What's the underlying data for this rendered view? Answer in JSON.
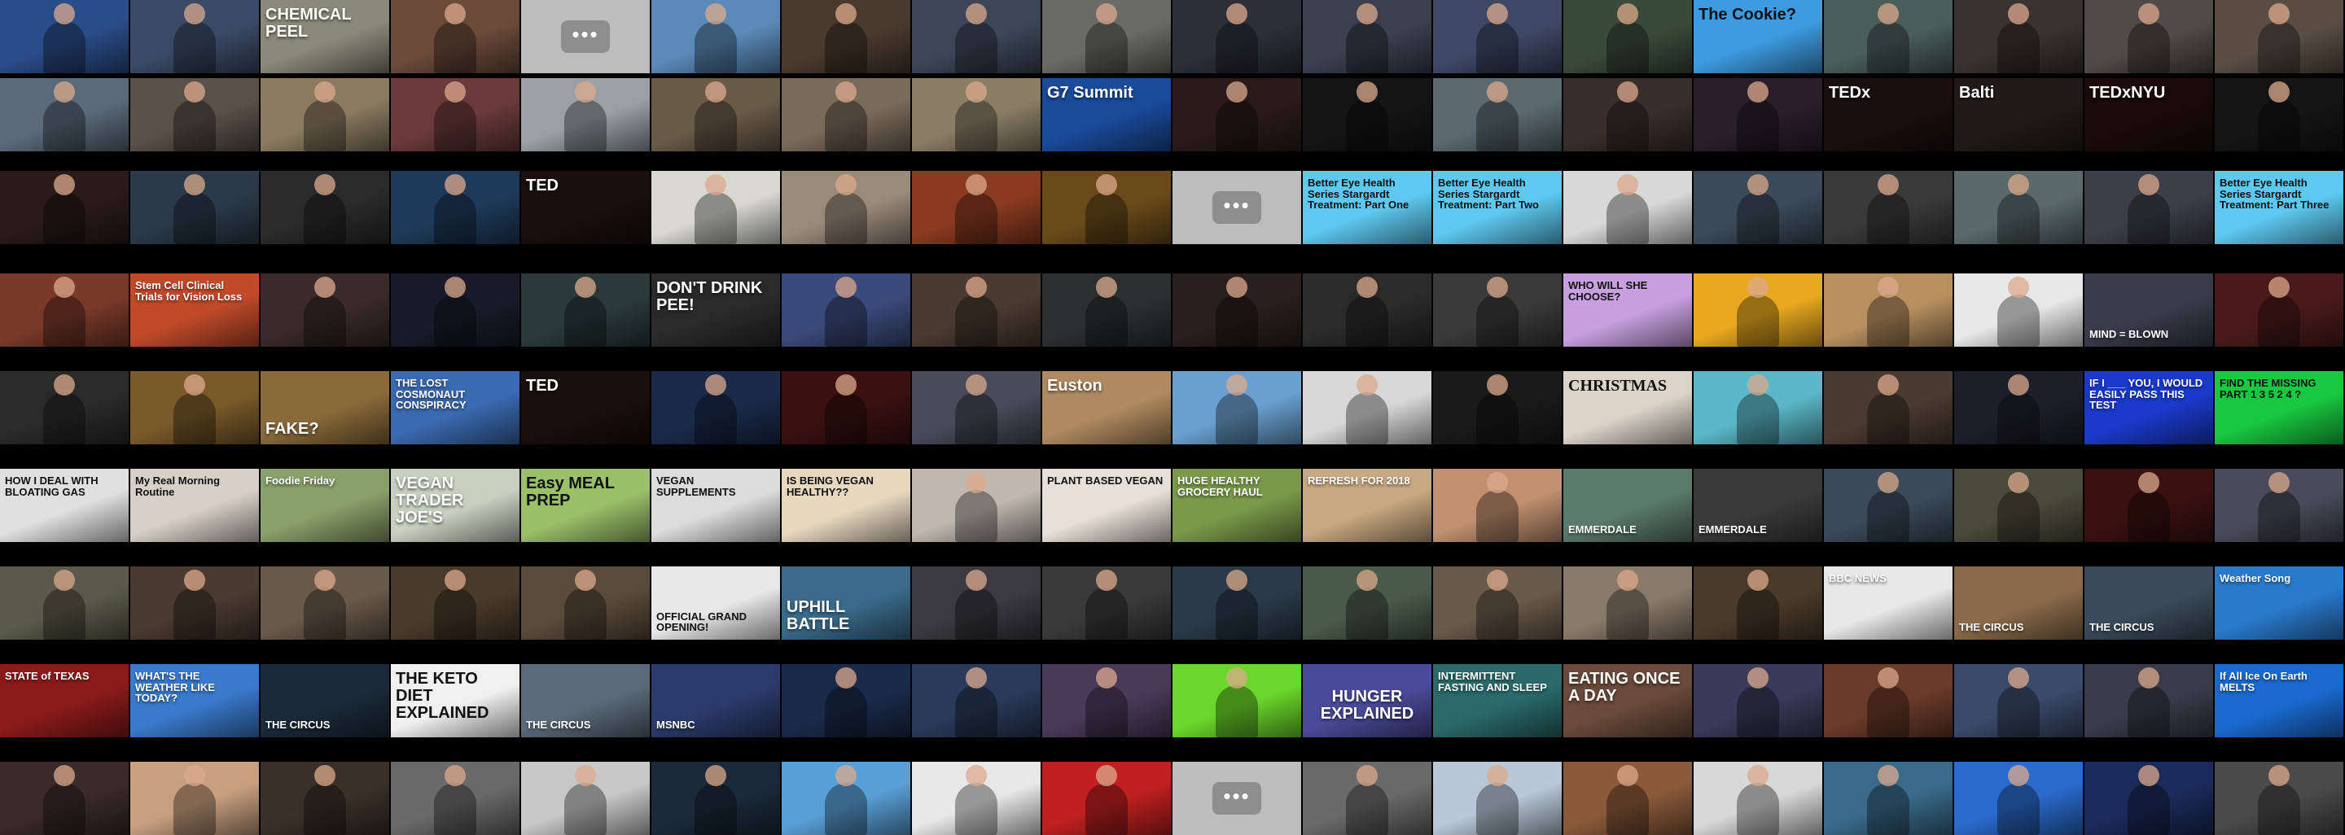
{
  "placeholder_glyph": "•••",
  "rows": [
    {
      "tiles": [
        {
          "bg": "#2a4c88"
        },
        {
          "bg": "#3a4a66"
        },
        {
          "bg": "#8a8a7a",
          "caption": "CHEMICAL PEEL"
        },
        {
          "bg": "#6b4a3a"
        },
        {
          "placeholder": true
        },
        {
          "bg": "#5a8ab8"
        },
        {
          "bg": "#4a3a2e"
        },
        {
          "bg": "#3c4658"
        },
        {
          "bg": "#6a6a66"
        },
        {
          "bg": "#2e2e3a"
        },
        {
          "bg": "#3a4050"
        },
        {
          "bg": "#3e4866"
        },
        {
          "bg": "#3a4a3a"
        },
        {
          "bg": "#3d9be0",
          "caption": "The Cookie?",
          "captionStyle": "dark"
        },
        {
          "bg": "#4a5e5a"
        },
        {
          "bg": "#3a3230"
        },
        {
          "bg": "#504a48"
        },
        {
          "bg": "#5a4e44"
        }
      ]
    },
    {
      "tiles": [
        {
          "bg": "#5a6a7a"
        },
        {
          "bg": "#5a5048"
        },
        {
          "bg": "#8a7a60"
        },
        {
          "bg": "#6a3a3a"
        },
        {
          "bg": "#9aa0a4"
        },
        {
          "bg": "#6a5a48"
        },
        {
          "bg": "#7a6a5a"
        },
        {
          "bg": "#8a7e66"
        },
        {
          "bg": "#1a4a9a",
          "caption": "G7 Summit"
        },
        {
          "bg": "#2a1a1a"
        },
        {
          "bg": "#141414"
        },
        {
          "bg": "#5a6a70"
        },
        {
          "bg": "#3a2e2a"
        },
        {
          "bg": "#2a1e2a"
        },
        {
          "bg": "#1a0e10",
          "caption": "TEDx"
        },
        {
          "bg": "#201a1a",
          "caption": "Balti"
        },
        {
          "bg": "#1a0a0a",
          "caption": "TEDxNYU"
        },
        {
          "bg": "#141414"
        }
      ]
    },
    {
      "tiles": [
        {
          "bg": "#2a1a1a"
        },
        {
          "bg": "#2a3a4a"
        },
        {
          "bg": "#2a2a2a"
        },
        {
          "bg": "#1e3a5a"
        },
        {
          "bg": "#1a0e0e",
          "caption": "TED"
        },
        {
          "bg": "#d8d8d0"
        },
        {
          "bg": "#9a8a7a"
        },
        {
          "bg": "#8a3a20"
        },
        {
          "bg": "#6a4a1a"
        },
        {
          "placeholder": true
        },
        {
          "bg": "#5ec8f0",
          "caption": "Better Eye Health Series Stargardt Treatment: Part One",
          "captionStyle": "small dark"
        },
        {
          "bg": "#5ec8f0",
          "caption": "Better Eye Health Series Stargardt Treatment: Part Two",
          "captionStyle": "small dark"
        },
        {
          "bg": "#d8d8d8"
        },
        {
          "bg": "#3a4a5a"
        },
        {
          "bg": "#3a3a3a"
        },
        {
          "bg": "#5a6a6a"
        },
        {
          "bg": "#3e3e4a"
        },
        {
          "bg": "#5ec8f0",
          "caption": "Better Eye Health Series Stargardt Treatment: Part Three",
          "captionStyle": "small dark"
        }
      ]
    },
    {
      "tiles": [
        {
          "bg": "#7a3a2a"
        },
        {
          "bg": "#c04a2a",
          "caption": "Stem Cell Clinical Trials for Vision Loss",
          "captionStyle": "small"
        },
        {
          "bg": "#3a2a2a"
        },
        {
          "bg": "#1a1a2a"
        },
        {
          "bg": "#2a3a3a"
        },
        {
          "bg": "#2a2a2a",
          "caption": "DON'T DRINK PEE!"
        },
        {
          "bg": "#3a4a7a"
        },
        {
          "bg": "#4a3a30"
        },
        {
          "bg": "#2a3030"
        },
        {
          "bg": "#2a1e1e"
        },
        {
          "bg": "#2a2a2a"
        },
        {
          "bg": "#3a3a3a"
        },
        {
          "bg": "#c8a0e0",
          "caption": "WHO WILL SHE CHOOSE?",
          "captionStyle": "small dark"
        },
        {
          "bg": "#e8a820"
        },
        {
          "bg": "#b89060"
        },
        {
          "bg": "#e8e8e8"
        },
        {
          "bg": "#3a3a4a",
          "caption": "MIND = BLOWN",
          "captionStyle": "small bottom"
        },
        {
          "bg": "#4a1a1a"
        }
      ]
    },
    {
      "tiles": [
        {
          "bg": "#2a2a2a"
        },
        {
          "bg": "#7a5a2a"
        },
        {
          "bg": "#8a6a3a",
          "caption": "FAKE?",
          "captionStyle": "bottom"
        },
        {
          "bg": "#3a6ab0",
          "caption": "THE LOST COSMONAUT CONSPIRACY",
          "captionStyle": "small"
        },
        {
          "bg": "#1a0e0e",
          "caption": "TED"
        },
        {
          "bg": "#1a2a4a"
        },
        {
          "bg": "#3a1010"
        },
        {
          "bg": "#4a4a5a"
        },
        {
          "bg": "#b08a60",
          "caption": "Euston"
        },
        {
          "bg": "#6aa0d0"
        },
        {
          "bg": "#d8d8d8"
        },
        {
          "bg": "#1a1a1a"
        },
        {
          "bg": "#dcd4c8",
          "caption": "CHRISTMAS",
          "captionStyle": "serif dark"
        },
        {
          "bg": "#5ab8c8"
        },
        {
          "bg": "#4a3a30"
        },
        {
          "bg": "#1e1e2a"
        },
        {
          "bg": "#1a3acc",
          "caption": "IF I ___ YOU, I WOULD EASILY PASS THIS TEST",
          "captionStyle": "small"
        },
        {
          "bg": "#18c840",
          "caption": "FIND THE MISSING PART 1 3 5 2 4 ?",
          "captionStyle": "small dark"
        }
      ]
    },
    {
      "tiles": [
        {
          "bg": "#e0e0e0",
          "caption": "HOW I DEAL WITH BLOATING GAS",
          "captionStyle": "small dark"
        },
        {
          "bg": "#d8d0c8",
          "caption": "My Real Morning Routine",
          "captionStyle": "small dark"
        },
        {
          "bg": "#8aa06a",
          "caption": "Foodie Friday",
          "captionStyle": "small"
        },
        {
          "bg": "#c8d0c0",
          "caption": "VEGAN TRADER JOE'S"
        },
        {
          "bg": "#9ac06a",
          "caption": "Easy MEAL PREP",
          "captionStyle": "dark"
        },
        {
          "bg": "#dcdcdc",
          "caption": "VEGAN SUPPLEMENTS",
          "captionStyle": "small dark"
        },
        {
          "bg": "#e8d8c0",
          "caption": "IS BEING VEGAN HEALTHY??",
          "captionStyle": "small dark"
        },
        {
          "bg": "#c0b8b0"
        },
        {
          "bg": "#e8e0d8",
          "caption": "PLANT BASED VEGAN",
          "captionStyle": "small dark"
        },
        {
          "bg": "#7a9a4a",
          "caption": "HUGE HEALTHY GROCERY HAUL",
          "captionStyle": "small"
        },
        {
          "bg": "#c8a880",
          "caption": "REFRESH FOR 2018",
          "captionStyle": "small"
        },
        {
          "bg": "#c09070"
        },
        {
          "bg": "#5a7a6a",
          "caption": "EMMERDALE",
          "captionStyle": "small bottom"
        },
        {
          "bg": "#3a3a3a",
          "caption": "EMMERDALE",
          "captionStyle": "small bottom"
        },
        {
          "bg": "#3a4a5a"
        },
        {
          "bg": "#4a4a3a"
        },
        {
          "bg": "#3a1010"
        },
        {
          "bg": "#4a4a5a"
        }
      ]
    },
    {
      "tiles": [
        {
          "bg": "#5a5a4a"
        },
        {
          "bg": "#4a3a30"
        },
        {
          "bg": "#6a5a4a"
        },
        {
          "bg": "#4a3a2a"
        },
        {
          "bg": "#5a4a3a"
        },
        {
          "bg": "#e8e8e8",
          "caption": "OFFICIAL GRAND OPENING!",
          "captionStyle": "small bottom dark"
        },
        {
          "bg": "#3a6a8a",
          "caption": "UPHILL BATTLE",
          "captionStyle": "bottom"
        },
        {
          "bg": "#3a3a40"
        },
        {
          "bg": "#3a3a3a"
        },
        {
          "bg": "#2a3a4a"
        },
        {
          "bg": "#4a5a4a"
        },
        {
          "bg": "#6a5a4a"
        },
        {
          "bg": "#8a7a6a"
        },
        {
          "bg": "#4a3a2a"
        },
        {
          "bg": "#e8e8e8",
          "caption": "BBC NEWS",
          "captionStyle": "small"
        },
        {
          "bg": "#8a6a4a",
          "caption": "THE CIRCUS",
          "captionStyle": "small bottom"
        },
        {
          "bg": "#3a4a5a",
          "caption": "THE CIRCUS",
          "captionStyle": "small bottom"
        },
        {
          "bg": "#2a7acc",
          "caption": "Weather Song",
          "captionStyle": "small"
        }
      ]
    },
    {
      "tiles": [
        {
          "bg": "#8a1a1a",
          "caption": "STATE of TEXAS",
          "captionStyle": "small"
        },
        {
          "bg": "#3a7acc",
          "caption": "WHAT'S THE WEATHER LIKE TODAY?",
          "captionStyle": "small"
        },
        {
          "bg": "#1a2a3a",
          "caption": "THE CIRCUS",
          "captionStyle": "small bottom"
        },
        {
          "bg": "#f0f0f0",
          "caption": "THE KETO DIET EXPLAINED",
          "captionStyle": "dark"
        },
        {
          "bg": "#5a6a7a",
          "caption": "THE CIRCUS",
          "captionStyle": "small bottom"
        },
        {
          "bg": "#2a3a6a",
          "caption": "MSNBC",
          "captionStyle": "small bottom"
        },
        {
          "bg": "#1a2a4a"
        },
        {
          "bg": "#2a3a5a"
        },
        {
          "bg": "#4a3a5a"
        },
        {
          "bg": "#6ad82a"
        },
        {
          "bg": "#4a4a9a",
          "caption": "HUNGER EXPLAINED",
          "captionStyle": "center"
        },
        {
          "bg": "#2a6a6a",
          "caption": "INTERMITTENT FASTING AND SLEEP",
          "captionStyle": "small"
        },
        {
          "bg": "#6a4a3a",
          "caption": "EATING ONCE A DAY"
        },
        {
          "bg": "#3a3a5a"
        },
        {
          "bg": "#6a3a2a"
        },
        {
          "bg": "#3a4a6a"
        },
        {
          "bg": "#3a3a4a"
        },
        {
          "bg": "#1a6ad0",
          "caption": "If All Ice On Earth MELTS",
          "captionStyle": "small"
        }
      ]
    },
    {
      "tiles": [
        {
          "bg": "#3a2a2a"
        },
        {
          "bg": "#c8a080"
        },
        {
          "bg": "#3a3028"
        },
        {
          "bg": "#6a6a6a"
        },
        {
          "bg": "#c8c8c8"
        },
        {
          "bg": "#1a2a3a"
        },
        {
          "bg": "#5aa0d8"
        },
        {
          "bg": "#e8e8e8"
        },
        {
          "bg": "#c02020"
        },
        {
          "placeholder": true
        },
        {
          "bg": "#6a6a6a"
        },
        {
          "bg": "#b8c8d8"
        },
        {
          "bg": "#8a5a3a"
        },
        {
          "bg": "#d8d8d8"
        },
        {
          "bg": "#3a6a8a"
        },
        {
          "bg": "#2a6acc"
        },
        {
          "bg": "#1a2a5a"
        },
        {
          "bg": "#4a4a4a"
        }
      ]
    }
  ]
}
